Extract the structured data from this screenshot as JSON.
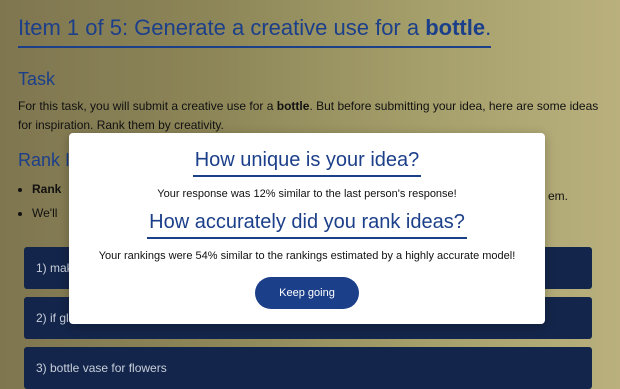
{
  "page": {
    "title_prefix": "Item 1 of 5: Generate a creative use for a ",
    "title_object": "bottle",
    "title_suffix": ".",
    "task_heading": "Task",
    "task_text_1": "For this task, you will submit a creative use for a ",
    "task_text_bold": "bottle",
    "task_text_2": ". But before submitting your idea, here are some ideas for inspiration. Rank them by creativity.",
    "rank_heading": "Rank I",
    "bullet_1_visible": "Rank",
    "bullet_1_tail": "em.",
    "bullet_2_visible": "We'll"
  },
  "ideas": [
    {
      "label": "1) mak"
    },
    {
      "label": "2) if gl"
    },
    {
      "label": "3) bottle vase for flowers"
    }
  ],
  "modal": {
    "heading_unique": "How unique is your idea?",
    "unique_text": "Your response was 12% similar to the last person's response!",
    "heading_accuracy": "How accurately did you rank ideas?",
    "accuracy_text": "Your rankings were 54% similar to the rankings estimated by a highly accurate model!",
    "button_label": "Keep going"
  }
}
